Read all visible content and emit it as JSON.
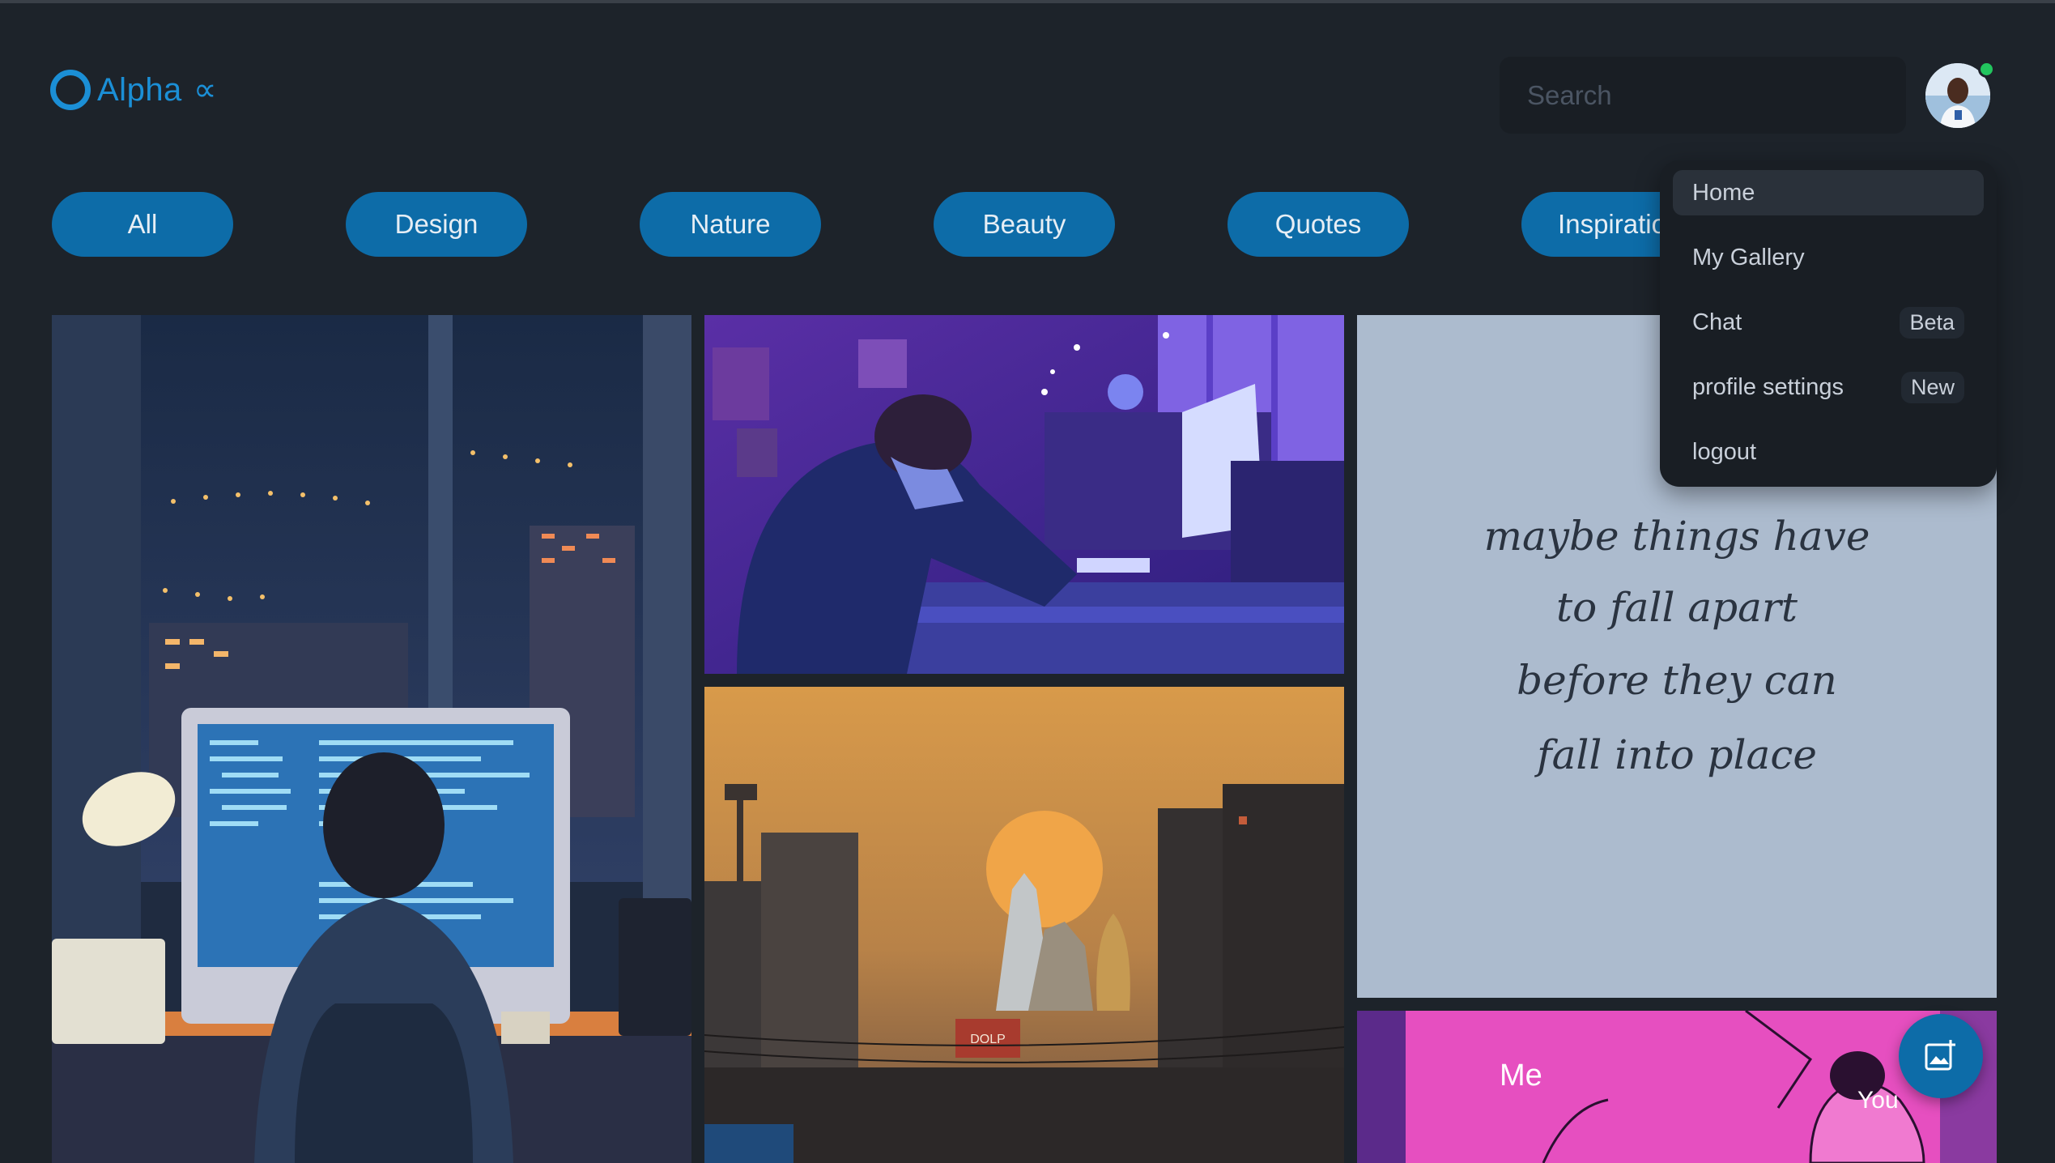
{
  "app": {
    "name": "Alpha",
    "symbol": "∝",
    "accent": "#1b8fd6"
  },
  "search": {
    "placeholder": "Search"
  },
  "categories": [
    "All",
    "Design",
    "Nature",
    "Beauty",
    "Quotes",
    "Inspiratio"
  ],
  "menu": {
    "items": [
      {
        "label": "Home",
        "badge": ""
      },
      {
        "label": "My Gallery",
        "badge": ""
      },
      {
        "label": "Chat",
        "badge": "Beta"
      },
      {
        "label": "profile settings",
        "badge": "New"
      },
      {
        "label": "logout",
        "badge": ""
      }
    ]
  },
  "gallery": {
    "note_lines": [
      "maybe things have",
      "to fall apart",
      "before they can",
      "fall into place"
    ],
    "comic_labels": {
      "left": "Me",
      "right": "You"
    },
    "sign_text": "DOLP"
  },
  "icons": {
    "fab": "add-image-icon",
    "logo": "circle-logo-icon"
  },
  "colors": {
    "background": "#1d232a",
    "chip": "#0d6ca8",
    "menu": "#191e24",
    "online": "#22c55e"
  }
}
